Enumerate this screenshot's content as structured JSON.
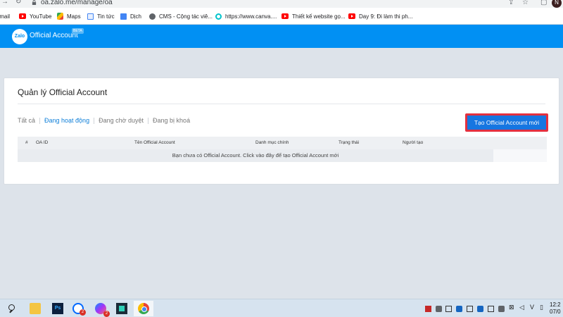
{
  "browser": {
    "url": "oa.zalo.me/manage/oa",
    "profile_initial": "N",
    "bookmarks": [
      {
        "label": "Email",
        "icon": "mail-icon"
      },
      {
        "label": "YouTube",
        "icon": "youtube-icon"
      },
      {
        "label": "Maps",
        "icon": "maps-icon"
      },
      {
        "label": "Tin tức",
        "icon": "news-icon"
      },
      {
        "label": "Dịch",
        "icon": "translate-icon"
      },
      {
        "label": "CMS - Cộng tác viê...",
        "icon": "globe-icon"
      },
      {
        "label": "https://www.canva....",
        "icon": "canva-icon"
      },
      {
        "label": "Thiết kế website gọ...",
        "icon": "youtube-icon"
      },
      {
        "label": "Day 9: Đi làm thi ph...",
        "icon": "youtube-icon"
      }
    ]
  },
  "header": {
    "logo_text": "Zalo",
    "title": "Official Account",
    "badge": "BETA",
    "color": "#0190f3"
  },
  "main": {
    "page_title": "Quản lý Official Account",
    "filters": [
      {
        "label": "Tất cả",
        "active": false
      },
      {
        "label": "Đang hoạt động",
        "active": true
      },
      {
        "label": "Đang chờ duyệt",
        "active": false
      },
      {
        "label": "Đang bị khoá",
        "active": false
      }
    ],
    "create_button": "Tạo Official Account mới",
    "table": {
      "columns": [
        "#",
        "OA ID",
        "Tên Official Account",
        "Danh mục chính",
        "Trạng thái",
        "Người tạo"
      ],
      "empty_message": "Bạn chưa có Official Account. Click vào đây để tạo Official Account mới"
    }
  },
  "taskbar": {
    "ps_label": "Ps",
    "zalo_badge": "2",
    "messenger_badge": "2",
    "clock_time": "12:2",
    "clock_date": "07/0"
  },
  "colors": {
    "accent": "#0190f3",
    "button": "#1676e1",
    "highlight_border": "#e3303f"
  }
}
